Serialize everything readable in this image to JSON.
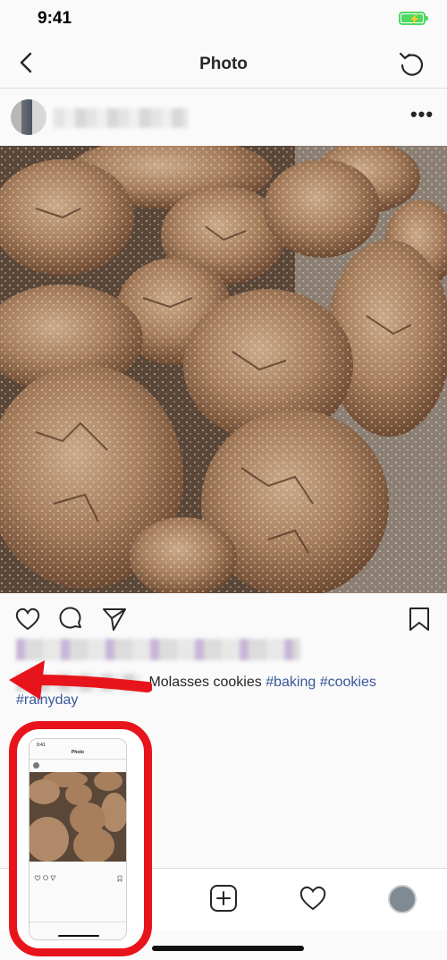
{
  "status_bar": {
    "time": "9:41",
    "battery_icon": "battery-charging-icon"
  },
  "nav": {
    "title": "Photo",
    "back_icon": "chevron-left-icon",
    "refresh_icon": "refresh-icon"
  },
  "post": {
    "more_icon": "more-horizontal-icon",
    "caption": {
      "text": "Molasses cookies",
      "hashtags": [
        "#baking",
        "#cookies"
      ],
      "hashtag_line2": "#rainyday"
    }
  },
  "actions": {
    "like_icon": "heart-icon",
    "comment_icon": "comment-icon",
    "share_icon": "send-icon",
    "save_icon": "bookmark-icon"
  },
  "tab_bar": {
    "new_post_icon": "plus-square-icon",
    "activity_icon": "heart-icon",
    "profile_icon": "avatar"
  },
  "thumbnail": {
    "time": "9:41",
    "title": "Photo"
  },
  "colors": {
    "accent_red": "#e8141b",
    "hashtag": "#385898",
    "battery": "#4cd964"
  }
}
